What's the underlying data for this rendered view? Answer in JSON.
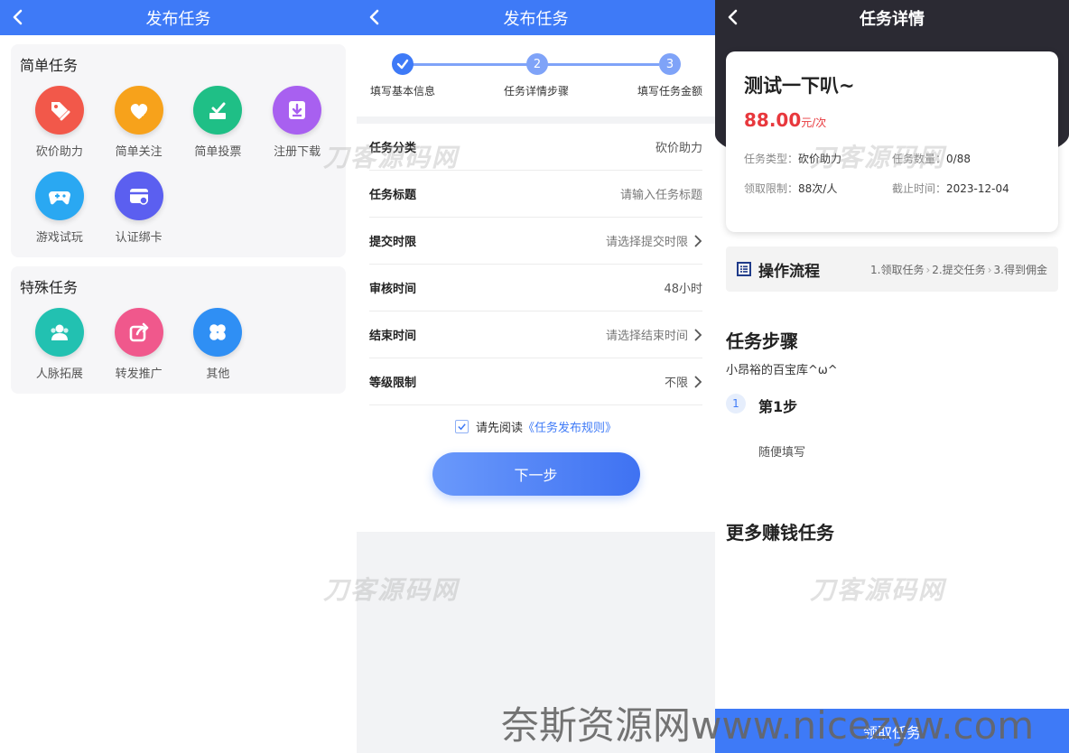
{
  "screen1": {
    "title": "发布任务",
    "simple": {
      "title": "简单任务",
      "items": [
        {
          "label": "砍价助力",
          "color": "#f2584a",
          "icon": "tag-off-icon"
        },
        {
          "label": "简单关注",
          "color": "#f7a21b",
          "icon": "heart-plus-icon"
        },
        {
          "label": "简单投票",
          "color": "#1fbf86",
          "icon": "vote-box-icon"
        },
        {
          "label": "注册下载",
          "color": "#a860f0",
          "icon": "download-icon"
        },
        {
          "label": "游戏试玩",
          "color": "#2aa8f2",
          "icon": "gamepad-icon"
        },
        {
          "label": "认证绑卡",
          "color": "#5b5ff0",
          "icon": "card-link-icon"
        }
      ]
    },
    "special": {
      "title": "特殊任务",
      "items": [
        {
          "label": "人脉拓展",
          "color": "#22c1b1",
          "icon": "people-icon"
        },
        {
          "label": "转发推广",
          "color": "#f0588c",
          "icon": "share-icon"
        },
        {
          "label": "其他",
          "color": "#2f8ff4",
          "icon": "clover-icon"
        }
      ]
    }
  },
  "screen2": {
    "title": "发布任务",
    "steps": [
      {
        "no": "",
        "label": "填写基本信息",
        "done": true
      },
      {
        "no": "2",
        "label": "任务详情步骤",
        "done": false
      },
      {
        "no": "3",
        "label": "填写任务金额",
        "done": false
      }
    ],
    "form": [
      {
        "key": "任务分类",
        "value": "砍价助力",
        "arrow": false,
        "placeholder": false
      },
      {
        "key": "任务标题",
        "value": "请输入任务标题",
        "arrow": false,
        "placeholder": true
      },
      {
        "key": "提交时限",
        "value": "请选择提交时限",
        "arrow": true,
        "placeholder": true
      },
      {
        "key": "审核时间",
        "value": "48小时",
        "arrow": false,
        "placeholder": false
      },
      {
        "key": "结束时间",
        "value": "请选择结束时间",
        "arrow": true,
        "placeholder": true
      },
      {
        "key": "等级限制",
        "value": "不限",
        "arrow": true,
        "placeholder": false
      }
    ],
    "agree_text": "请先阅读",
    "agree_link": "《任务发布规则》",
    "next_button": "下一步"
  },
  "screen3": {
    "title": "任务详情",
    "task_title": "测试一下叭~",
    "price": "88.00",
    "price_unit": "元/次",
    "meta": [
      {
        "key": "任务类型：",
        "value": "砍价助力"
      },
      {
        "key": "任务数量：",
        "value": "0/88"
      },
      {
        "key": "领取限制：",
        "value": "88次/人"
      },
      {
        "key": "截止时间：",
        "value": "2023-12-04"
      }
    ],
    "flow_title": "操作流程",
    "flow_steps": [
      "1.领取任务",
      "2.提交任务",
      "3.得到佣金"
    ],
    "steps_section": "任务步骤",
    "steps_desc": "小昂裕的百宝库^ω^",
    "step1_no": "1",
    "step1_title": "第1步",
    "step1_desc": "随便填写",
    "more_section": "更多赚钱任务",
    "claim_button": "领取任务"
  },
  "watermarks": {
    "brand": "刀客源码网",
    "footer": "奈斯资源网www.nicezyw.com"
  }
}
